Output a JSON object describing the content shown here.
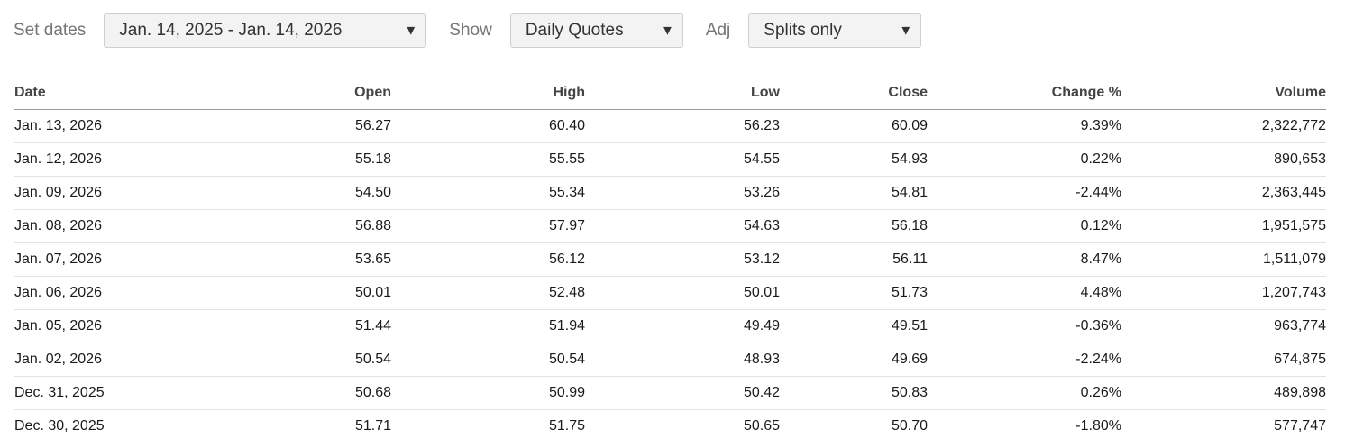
{
  "controls": {
    "set_dates_label": "Set dates",
    "date_range": "Jan. 14, 2025 - Jan. 14, 2026",
    "show_label": "Show",
    "show_value": "Daily Quotes",
    "adj_label": "Adj",
    "adj_value": "Splits only",
    "caret_icon": "chevron-down-icon"
  },
  "colors": {
    "positive": "#1e7a3e",
    "negative": "#c0303a"
  },
  "table": {
    "headers": {
      "date": "Date",
      "open": "Open",
      "high": "High",
      "low": "Low",
      "close": "Close",
      "change": "Change %",
      "volume": "Volume"
    },
    "rows": [
      {
        "date": "Jan. 13, 2026",
        "open": "56.27",
        "high": "60.40",
        "low": "56.23",
        "close": "60.09",
        "change": "9.39%",
        "volume": "2,322,772"
      },
      {
        "date": "Jan. 12, 2026",
        "open": "55.18",
        "high": "55.55",
        "low": "54.55",
        "close": "54.93",
        "change": "0.22%",
        "volume": "890,653"
      },
      {
        "date": "Jan. 09, 2026",
        "open": "54.50",
        "high": "55.34",
        "low": "53.26",
        "close": "54.81",
        "change": "-2.44%",
        "volume": "2,363,445"
      },
      {
        "date": "Jan. 08, 2026",
        "open": "56.88",
        "high": "57.97",
        "low": "54.63",
        "close": "56.18",
        "change": "0.12%",
        "volume": "1,951,575"
      },
      {
        "date": "Jan. 07, 2026",
        "open": "53.65",
        "high": "56.12",
        "low": "53.12",
        "close": "56.11",
        "change": "8.47%",
        "volume": "1,511,079"
      },
      {
        "date": "Jan. 06, 2026",
        "open": "50.01",
        "high": "52.48",
        "low": "50.01",
        "close": "51.73",
        "change": "4.48%",
        "volume": "1,207,743"
      },
      {
        "date": "Jan. 05, 2026",
        "open": "51.44",
        "high": "51.94",
        "low": "49.49",
        "close": "49.51",
        "change": "-0.36%",
        "volume": "963,774"
      },
      {
        "date": "Jan. 02, 2026",
        "open": "50.54",
        "high": "50.54",
        "low": "48.93",
        "close": "49.69",
        "change": "-2.24%",
        "volume": "674,875"
      },
      {
        "date": "Dec. 31, 2025",
        "open": "50.68",
        "high": "50.99",
        "low": "50.42",
        "close": "50.83",
        "change": "0.26%",
        "volume": "489,898"
      },
      {
        "date": "Dec. 30, 2025",
        "open": "51.71",
        "high": "51.75",
        "low": "50.65",
        "close": "50.70",
        "change": "-1.80%",
        "volume": "577,747"
      }
    ]
  }
}
